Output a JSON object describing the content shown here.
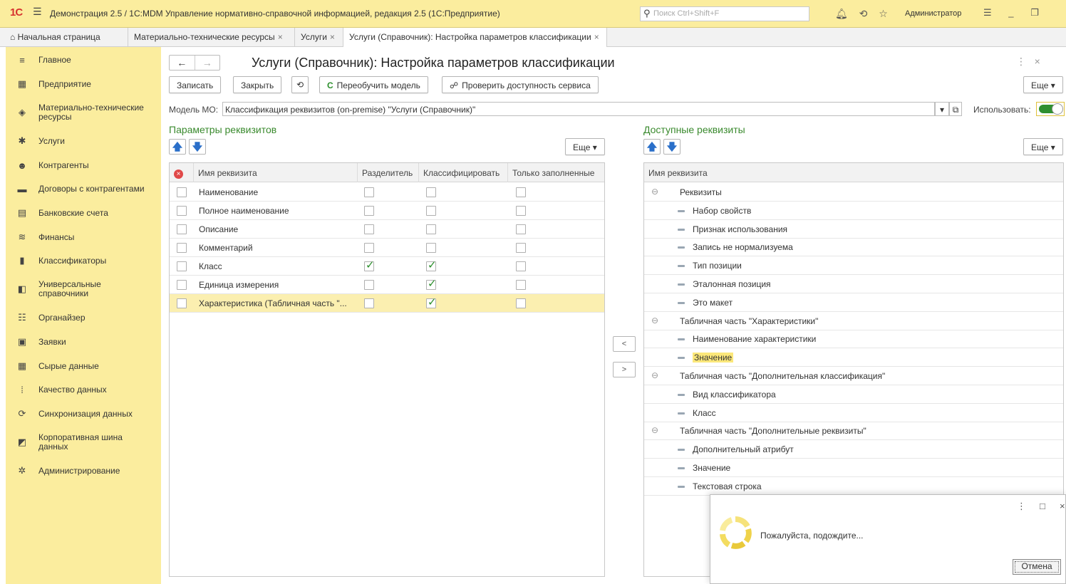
{
  "window": {
    "logo": "1С",
    "title": "Демонстрация 2.5 / 1С:MDM Управление нормативно-справочной информацией, редакция 2.5  (1С:Предприятие)",
    "search_placeholder": "Поиск Ctrl+Shift+F",
    "user": "Администратор"
  },
  "tabs": [
    {
      "label": "Начальная страница",
      "icon": "home-icon"
    },
    {
      "label": "Материально-технические ресурсы",
      "close": "×"
    },
    {
      "label": "Услуги",
      "close": "×"
    },
    {
      "label": "Услуги (Справочник): Настройка параметров классификации",
      "close": "×",
      "active": true
    }
  ],
  "sidebar": {
    "items": [
      {
        "label": "Главное",
        "icon": "menu-icon"
      },
      {
        "label": "Предприятие",
        "icon": "building-icon"
      },
      {
        "label": "Материально-технические ресурсы",
        "icon": "cube-icon"
      },
      {
        "label": "Услуги",
        "icon": "service-icon"
      },
      {
        "label": "Контрагенты",
        "icon": "people-icon"
      },
      {
        "label": "Договоры с контрагентами",
        "icon": "contract-icon"
      },
      {
        "label": "Банковские счета",
        "icon": "bank-icon"
      },
      {
        "label": "Финансы",
        "icon": "finance-icon"
      },
      {
        "label": "Классификаторы",
        "icon": "classifier-icon"
      },
      {
        "label": "Универсальные справочники",
        "icon": "catalog-icon"
      },
      {
        "label": "Органайзер",
        "icon": "organizer-icon"
      },
      {
        "label": "Заявки",
        "icon": "requests-icon"
      },
      {
        "label": "Сырые данные",
        "icon": "raw-data-icon"
      },
      {
        "label": "Качество данных",
        "icon": "quality-icon"
      },
      {
        "label": "Синхронизация данных",
        "icon": "sync-icon"
      },
      {
        "label": "Корпоративная шина данных",
        "icon": "bus-icon"
      },
      {
        "label": "Администрирование",
        "icon": "gear-icon"
      }
    ]
  },
  "page": {
    "title": "Услуги (Справочник): Настройка параметров классификации",
    "buttons": {
      "save": "Записать",
      "close": "Закрыть",
      "retrain": "Переобучить модель",
      "check": "Проверить доступность сервиса",
      "more": "Еще"
    },
    "model_label": "Модель МО:",
    "model_value": "Классификация реквизитов (on-premise) \"Услуги (Справочник)\"",
    "use_label": "Использовать:",
    "use_enabled": true
  },
  "left_table": {
    "heading": "Параметры реквизитов",
    "more": "Еще",
    "columns": [
      "Имя реквизита",
      "Разделитель",
      "Классифицировать",
      "Только заполненные"
    ],
    "rows": [
      {
        "name": "Наименование",
        "sep": false,
        "cls": false,
        "filled": false
      },
      {
        "name": "Полное наименование",
        "sep": false,
        "cls": false,
        "filled": false
      },
      {
        "name": "Описание",
        "sep": false,
        "cls": false,
        "filled": false
      },
      {
        "name": "Комментарий",
        "sep": false,
        "cls": false,
        "filled": false
      },
      {
        "name": "Класс",
        "sep": true,
        "cls": true,
        "filled": false
      },
      {
        "name": "Единица измерения",
        "sep": false,
        "cls": true,
        "filled": false
      },
      {
        "name": "Характеристика (Табличная часть \"...",
        "sep": false,
        "cls": true,
        "filled": false,
        "selected": true
      }
    ]
  },
  "move_buttons": {
    "left": "<",
    "right": ">"
  },
  "right_table": {
    "heading": "Доступные реквизиты",
    "more": "Еще",
    "column": "Имя реквизита",
    "rows": [
      {
        "label": "Реквизиты",
        "group": true
      },
      {
        "label": "Набор свойств"
      },
      {
        "label": "Признак использования"
      },
      {
        "label": "Запись не нормализуема"
      },
      {
        "label": "Тип позиции"
      },
      {
        "label": "Эталонная позиция"
      },
      {
        "label": "Это макет"
      },
      {
        "label": "Табличная часть \"Характеристики\"",
        "group": true
      },
      {
        "label": "Наименование характеристики"
      },
      {
        "label": "Значение",
        "highlight": true
      },
      {
        "label": "Табличная часть \"Дополнительная классификация\"",
        "group": true
      },
      {
        "label": "Вид классификатора"
      },
      {
        "label": "Класс"
      },
      {
        "label": "Табличная часть \"Дополнительные реквизиты\"",
        "group": true
      },
      {
        "label": "Дополнительный атрибут"
      },
      {
        "label": "Значение"
      },
      {
        "label": "Текстовая строка"
      }
    ]
  },
  "wait_dialog": {
    "text": "Пожалуйста, подождите...",
    "cancel": "Отмена"
  }
}
